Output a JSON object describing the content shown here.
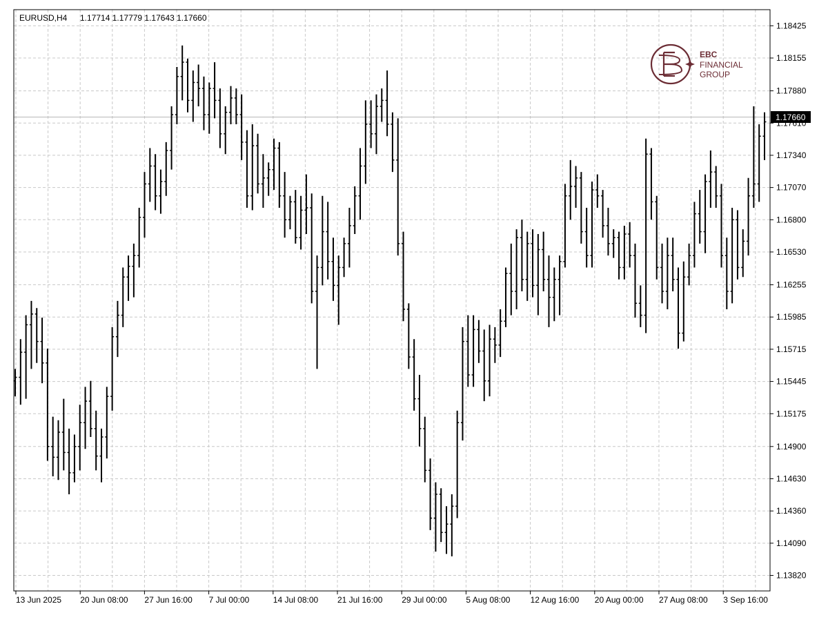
{
  "header": {
    "symbol_tf": "EURUSD,H4",
    "ohlc": "1.17714 1.17779 1.17643 1.17660"
  },
  "logo": {
    "line1": "EBC",
    "line2": "FINANCIAL",
    "line3": "GROUP",
    "color": "#6b2c34"
  },
  "colors": {
    "bars": "#000000",
    "grid": "#c8c8c8",
    "price_line": "#b4b4b4",
    "price_tag_bg": "#000000",
    "price_tag_text": "#ffffff"
  },
  "chart_data": {
    "type": "ohlc",
    "title": "EURUSD,H4",
    "ylim": [
      1.1369,
      1.1856
    ],
    "yticks": [
      "1.18425",
      "1.18155",
      "1.17880",
      "1.17610",
      "1.17340",
      "1.17070",
      "1.16800",
      "1.16530",
      "1.16255",
      "1.15985",
      "1.15715",
      "1.15445",
      "1.15175",
      "1.14900",
      "1.14630",
      "1.14360",
      "1.14090",
      "1.13820"
    ],
    "xticks": [
      "13 Jun 2025",
      "20 Jun 08:00",
      "27 Jun 16:00",
      "7 Jul 00:00",
      "14 Jul 08:00",
      "21 Jul 16:00",
      "29 Jul 00:00",
      "5 Aug 08:00",
      "12 Aug 16:00",
      "20 Aug 00:00",
      "27 Aug 08:00",
      "3 Sep 16:00"
    ],
    "current_price": "1.17660",
    "grid": true,
    "bars": [
      [
        1.1545,
        1.1532,
        1.1555,
        1.1548
      ],
      [
        1.1548,
        1.1525,
        1.158,
        1.1569
      ],
      [
        1.1569,
        1.153,
        1.16,
        1.1592
      ],
      [
        1.1592,
        1.1555,
        1.1612,
        1.1601
      ],
      [
        1.1601,
        1.156,
        1.1606,
        1.1578
      ],
      [
        1.1578,
        1.1543,
        1.1598,
        1.156
      ],
      [
        1.156,
        1.1478,
        1.1572,
        1.149
      ],
      [
        1.149,
        1.1465,
        1.1515,
        1.1481
      ],
      [
        1.1481,
        1.1462,
        1.1512,
        1.1502
      ],
      [
        1.1502,
        1.147,
        1.153,
        1.1485
      ],
      [
        1.1485,
        1.145,
        1.1505,
        1.1468
      ],
      [
        1.1468,
        1.146,
        1.15,
        1.149
      ],
      [
        1.149,
        1.147,
        1.1525,
        1.151
      ],
      [
        1.151,
        1.1488,
        1.154,
        1.1528
      ],
      [
        1.1528,
        1.1498,
        1.1545,
        1.1505
      ],
      [
        1.1505,
        1.147,
        1.152,
        1.1482
      ],
      [
        1.1482,
        1.146,
        1.1505,
        1.1498
      ],
      [
        1.1498,
        1.148,
        1.154,
        1.1532
      ],
      [
        1.1532,
        1.152,
        1.159,
        1.1582
      ],
      [
        1.1582,
        1.1565,
        1.1612,
        1.16
      ],
      [
        1.16,
        1.159,
        1.164,
        1.1632
      ],
      [
        1.1632,
        1.1612,
        1.165,
        1.1641
      ],
      [
        1.1641,
        1.1615,
        1.166,
        1.165
      ],
      [
        1.165,
        1.164,
        1.169,
        1.1682
      ],
      [
        1.1682,
        1.1665,
        1.172,
        1.171
      ],
      [
        1.171,
        1.1695,
        1.174,
        1.1725
      ],
      [
        1.1725,
        1.1688,
        1.1735,
        1.17
      ],
      [
        1.17,
        1.1685,
        1.1722,
        1.1712
      ],
      [
        1.1712,
        1.17,
        1.1745,
        1.1738
      ],
      [
        1.1738,
        1.1722,
        1.1775,
        1.1768
      ],
      [
        1.1768,
        1.176,
        1.1808,
        1.18
      ],
      [
        1.18,
        1.178,
        1.1826,
        1.1812
      ],
      [
        1.1812,
        1.177,
        1.1815,
        1.178
      ],
      [
        1.178,
        1.1762,
        1.1805,
        1.1795
      ],
      [
        1.1795,
        1.1775,
        1.181,
        1.179
      ],
      [
        1.179,
        1.1755,
        1.18,
        1.1768
      ],
      [
        1.1768,
        1.1752,
        1.1795,
        1.179
      ],
      [
        1.179,
        1.1765,
        1.1812,
        1.178
      ],
      [
        1.178,
        1.174,
        1.179,
        1.1752
      ],
      [
        1.1752,
        1.1735,
        1.1775,
        1.177
      ],
      [
        1.177,
        1.176,
        1.1792,
        1.1782
      ],
      [
        1.1782,
        1.176,
        1.179,
        1.1768
      ],
      [
        1.1768,
        1.173,
        1.1785,
        1.1745
      ],
      [
        1.1745,
        1.169,
        1.1755,
        1.17
      ],
      [
        1.17,
        1.1688,
        1.176,
        1.1742
      ],
      [
        1.1742,
        1.1702,
        1.1752,
        1.171
      ],
      [
        1.171,
        1.169,
        1.1735,
        1.1715
      ],
      [
        1.1715,
        1.17,
        1.1728,
        1.1722
      ],
      [
        1.1722,
        1.1705,
        1.1748,
        1.174
      ],
      [
        1.174,
        1.169,
        1.1745,
        1.17
      ],
      [
        1.17,
        1.1665,
        1.172,
        1.168
      ],
      [
        1.168,
        1.1672,
        1.17,
        1.1695
      ],
      [
        1.1695,
        1.166,
        1.1705,
        1.1665
      ],
      [
        1.1665,
        1.1655,
        1.17,
        1.1688
      ],
      [
        1.1688,
        1.1668,
        1.1718,
        1.169
      ],
      [
        1.169,
        1.161,
        1.1702,
        1.162
      ],
      [
        1.162,
        1.1555,
        1.165,
        1.164
      ],
      [
        1.164,
        1.1625,
        1.17,
        1.167
      ],
      [
        1.167,
        1.163,
        1.1695,
        1.1645
      ],
      [
        1.1645,
        1.1612,
        1.1665,
        1.1625
      ],
      [
        1.1625,
        1.1592,
        1.165,
        1.164
      ],
      [
        1.164,
        1.1632,
        1.1665,
        1.166
      ],
      [
        1.166,
        1.164,
        1.169,
        1.1675
      ],
      [
        1.1675,
        1.1668,
        1.1708,
        1.17
      ],
      [
        1.17,
        1.168,
        1.174,
        1.1725
      ],
      [
        1.1725,
        1.171,
        1.178,
        1.176
      ],
      [
        1.176,
        1.174,
        1.178,
        1.1752
      ],
      [
        1.1752,
        1.1735,
        1.1785,
        1.1775
      ],
      [
        1.1775,
        1.1762,
        1.179,
        1.178
      ],
      [
        1.178,
        1.175,
        1.1805,
        1.176
      ],
      [
        1.176,
        1.172,
        1.177,
        1.173
      ],
      [
        1.173,
        1.165,
        1.1765,
        1.166
      ],
      [
        1.166,
        1.1595,
        1.167,
        1.1605
      ],
      [
        1.1605,
        1.1555,
        1.161,
        1.1565
      ],
      [
        1.1565,
        1.152,
        1.158,
        1.153
      ],
      [
        1.153,
        1.149,
        1.155,
        1.1505
      ],
      [
        1.1505,
        1.146,
        1.1515,
        1.147
      ],
      [
        1.147,
        1.142,
        1.148,
        1.143
      ],
      [
        1.143,
        1.1402,
        1.146,
        1.145
      ],
      [
        1.145,
        1.141,
        1.1455,
        1.1418
      ],
      [
        1.1418,
        1.14,
        1.144,
        1.1425
      ],
      [
        1.1425,
        1.1398,
        1.145,
        1.144
      ],
      [
        1.144,
        1.143,
        1.152,
        1.151
      ],
      [
        1.151,
        1.1495,
        1.159,
        1.1578
      ],
      [
        1.1578,
        1.154,
        1.16,
        1.155
      ],
      [
        1.155,
        1.154,
        1.16,
        1.1588
      ],
      [
        1.1588,
        1.156,
        1.1596,
        1.157
      ],
      [
        1.157,
        1.1528,
        1.1588,
        1.1545
      ],
      [
        1.1545,
        1.1532,
        1.1592,
        1.158
      ],
      [
        1.158,
        1.156,
        1.159,
        1.1575
      ],
      [
        1.1575,
        1.1565,
        1.1605,
        1.1595
      ],
      [
        1.1595,
        1.159,
        1.164,
        1.1635
      ],
      [
        1.1635,
        1.16,
        1.166,
        1.162
      ],
      [
        1.162,
        1.1605,
        1.1672,
        1.1665
      ],
      [
        1.1665,
        1.162,
        1.168,
        1.163
      ],
      [
        1.163,
        1.1612,
        1.167,
        1.166
      ],
      [
        1.166,
        1.1615,
        1.1672,
        1.1625
      ],
      [
        1.1625,
        1.16,
        1.1668,
        1.1655
      ],
      [
        1.1655,
        1.162,
        1.167,
        1.163
      ],
      [
        1.163,
        1.159,
        1.165,
        1.1615
      ],
      [
        1.1615,
        1.1595,
        1.164,
        1.163
      ],
      [
        1.163,
        1.16,
        1.165,
        1.1645
      ],
      [
        1.1645,
        1.164,
        1.171,
        1.17
      ],
      [
        1.17,
        1.168,
        1.173,
        1.1708
      ],
      [
        1.1708,
        1.169,
        1.1725,
        1.1715
      ],
      [
        1.1715,
        1.166,
        1.172,
        1.167
      ],
      [
        1.167,
        1.164,
        1.169,
        1.165
      ],
      [
        1.165,
        1.164,
        1.1712,
        1.1705
      ],
      [
        1.1705,
        1.169,
        1.1718,
        1.17
      ],
      [
        1.17,
        1.1665,
        1.1705,
        1.1675
      ],
      [
        1.1675,
        1.165,
        1.169,
        1.166
      ],
      [
        1.166,
        1.1648,
        1.1672,
        1.1665
      ],
      [
        1.1665,
        1.163,
        1.167,
        1.164
      ],
      [
        1.164,
        1.163,
        1.1675,
        1.1668
      ],
      [
        1.1668,
        1.164,
        1.1678,
        1.165
      ],
      [
        1.165,
        1.1598,
        1.166,
        1.161
      ],
      [
        1.161,
        1.159,
        1.1625,
        1.16
      ],
      [
        1.16,
        1.1585,
        1.1748,
        1.1735
      ],
      [
        1.1735,
        1.168,
        1.174,
        1.1695
      ],
      [
        1.1695,
        1.163,
        1.17,
        1.164
      ],
      [
        1.164,
        1.161,
        1.166,
        1.162
      ],
      [
        1.162,
        1.1605,
        1.1665,
        1.165
      ],
      [
        1.165,
        1.162,
        1.1665,
        1.163
      ],
      [
        1.163,
        1.1572,
        1.164,
        1.1585
      ],
      [
        1.1585,
        1.1578,
        1.1645,
        1.1632
      ],
      [
        1.1632,
        1.1625,
        1.166,
        1.165
      ],
      [
        1.165,
        1.164,
        1.1695,
        1.1685
      ],
      [
        1.1685,
        1.166,
        1.1705,
        1.167
      ],
      [
        1.167,
        1.1652,
        1.1718,
        1.1712
      ],
      [
        1.1712,
        1.169,
        1.1738,
        1.172
      ],
      [
        1.172,
        1.169,
        1.1725,
        1.17
      ],
      [
        1.17,
        1.164,
        1.171,
        1.165
      ],
      [
        1.165,
        1.1605,
        1.1665,
        1.162
      ],
      [
        1.162,
        1.161,
        1.169,
        1.168
      ],
      [
        1.168,
        1.163,
        1.1688,
        1.164
      ],
      [
        1.164,
        1.1632,
        1.1672,
        1.1662
      ],
      [
        1.1662,
        1.165,
        1.1715,
        1.17
      ],
      [
        1.17,
        1.169,
        1.1775,
        1.171
      ],
      [
        1.171,
        1.1695,
        1.176,
        1.175
      ],
      [
        1.175,
        1.173,
        1.177,
        1.1762
      ]
    ]
  }
}
